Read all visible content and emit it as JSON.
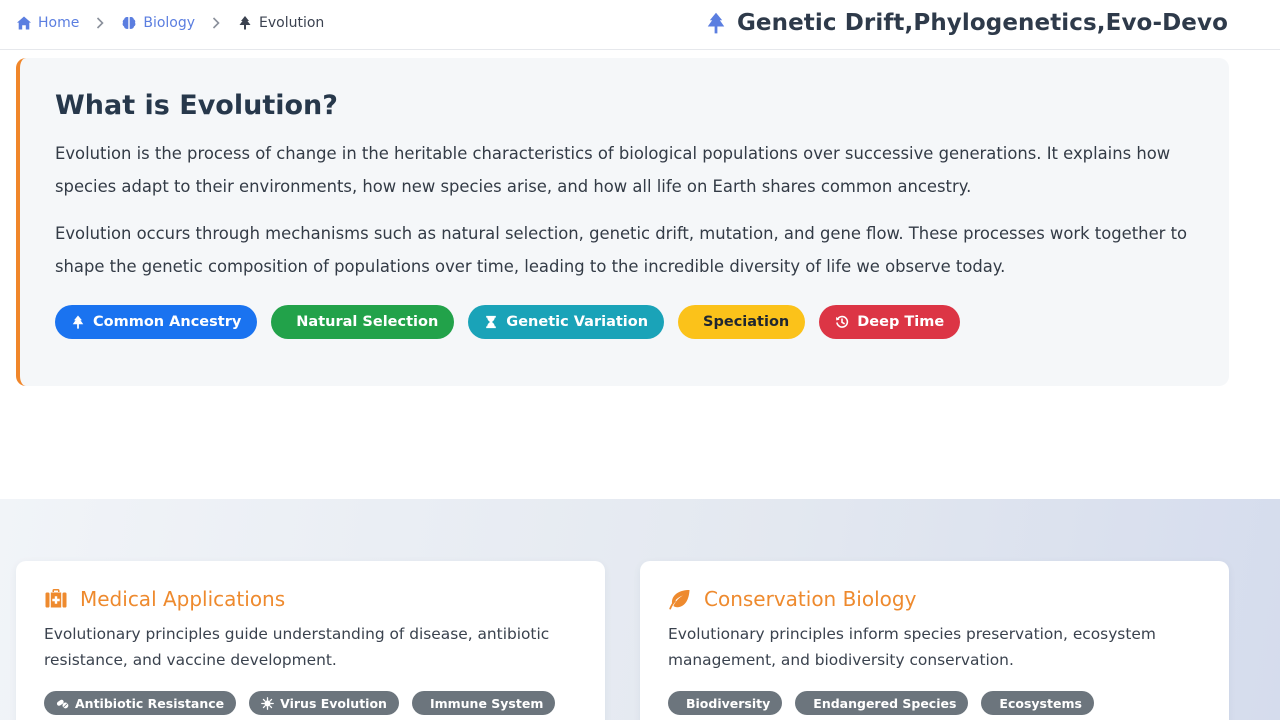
{
  "breadcrumb": {
    "home": "Home",
    "biology": "Biology",
    "current": "Evolution"
  },
  "page_title": "Genetic Drift,Phylogenetics,Evo-Devo",
  "intro": {
    "heading": "What is Evolution?",
    "paragraph1": "Evolution is the process of change in the heritable characteristics of biological populations over successive generations. It explains how species adapt to their environments, how new species arise, and how all life on Earth shares common ancestry.",
    "paragraph2": "Evolution occurs through mechanisms such as natural selection, genetic drift, mutation, and gene flow. These processes work together to shape the genetic composition of populations over time, leading to the incredible diversity of life we observe today.",
    "tags": [
      {
        "label": "Common Ancestry",
        "icon": "tree-icon",
        "color": "#1a73f0"
      },
      {
        "label": "Natural Selection",
        "icon": "",
        "color": "#22a24a"
      },
      {
        "label": "Genetic Variation",
        "icon": "hourglass-icon",
        "color": "#1aa3b8"
      },
      {
        "label": "Speciation",
        "icon": "",
        "color": "#fbc21a"
      },
      {
        "label": "Deep Time",
        "icon": "history-icon",
        "color": "#dc3545"
      }
    ]
  },
  "applications": {
    "medical": {
      "title": "Medical Applications",
      "icon": "first-aid-kit-icon",
      "description": "Evolutionary principles guide understanding of disease, antibiotic resistance, and vaccine development.",
      "pills": [
        {
          "label": "Antibiotic Resistance",
          "icon": "pills-icon"
        },
        {
          "label": "Virus Evolution",
          "icon": "virus-icon"
        },
        {
          "label": "Immune System",
          "icon": ""
        }
      ]
    },
    "conservation": {
      "title": "Conservation Biology",
      "icon": "leaf-icon",
      "description": "Evolutionary principles inform species preservation, ecosystem management, and biodiversity conservation.",
      "pills": [
        {
          "label": "Biodiversity"
        },
        {
          "label": "Endangered Species"
        },
        {
          "label": "Ecosystems"
        }
      ]
    }
  },
  "colors": {
    "accent_orange": "#f0862a",
    "link_blue": "#5b7ee0",
    "pill_gray": "#6c757d"
  }
}
